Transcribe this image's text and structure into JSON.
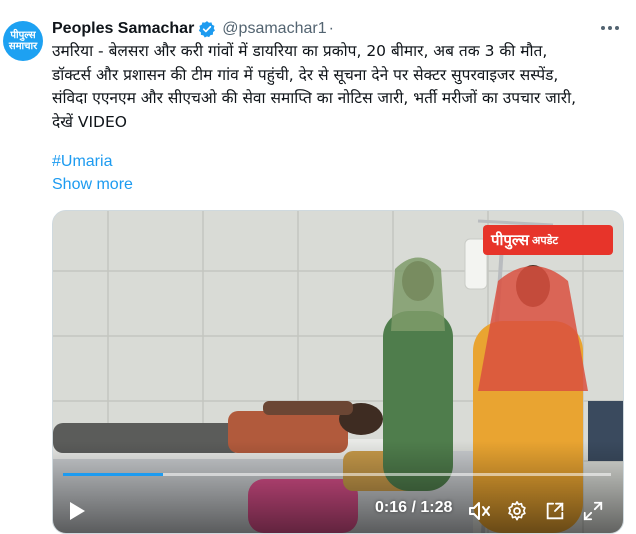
{
  "author": {
    "display_name": "Peoples Samachar",
    "handle": "@psamachar1",
    "separator": "·",
    "avatar_text_line1": "पीपुल्स",
    "avatar_text_line2": "समाचार"
  },
  "tweet": {
    "text": "उमरिया - बेलसरा और करी गांवों में डायरिया का प्रकोप, 20 बीमार, अब तक 3 की मौत,\nडॉक्टर्स और प्रशासन की टीम गांव में पहुंची, देर से सूचना देने पर सेक्टर सुपरवाइजर सस्पेंड,\nसंविदा एएनएम और सीएचओ की सेवा समाप्ति का नोटिस जारी, भर्ती मरीजों का उपचार जारी,\nदेखें VIDEO",
    "hashtag": "#Umaria",
    "show_more": "Show more"
  },
  "media": {
    "badge_main": "पीपुल्स",
    "badge_sub": "अपडेट",
    "time": "0:16 / 1:28",
    "progress": 0.182
  },
  "icons": {
    "verified": "verified-badge-icon",
    "more": "more-options-icon",
    "play": "play-icon",
    "mute": "muted-speaker-icon",
    "settings": "gear-icon",
    "pip": "picture-in-picture-icon",
    "fullscreen": "fullscreen-icon"
  },
  "colors": {
    "accent": "#1d9bf0",
    "badge": "#e7342a",
    "text_secondary": "#536471"
  }
}
